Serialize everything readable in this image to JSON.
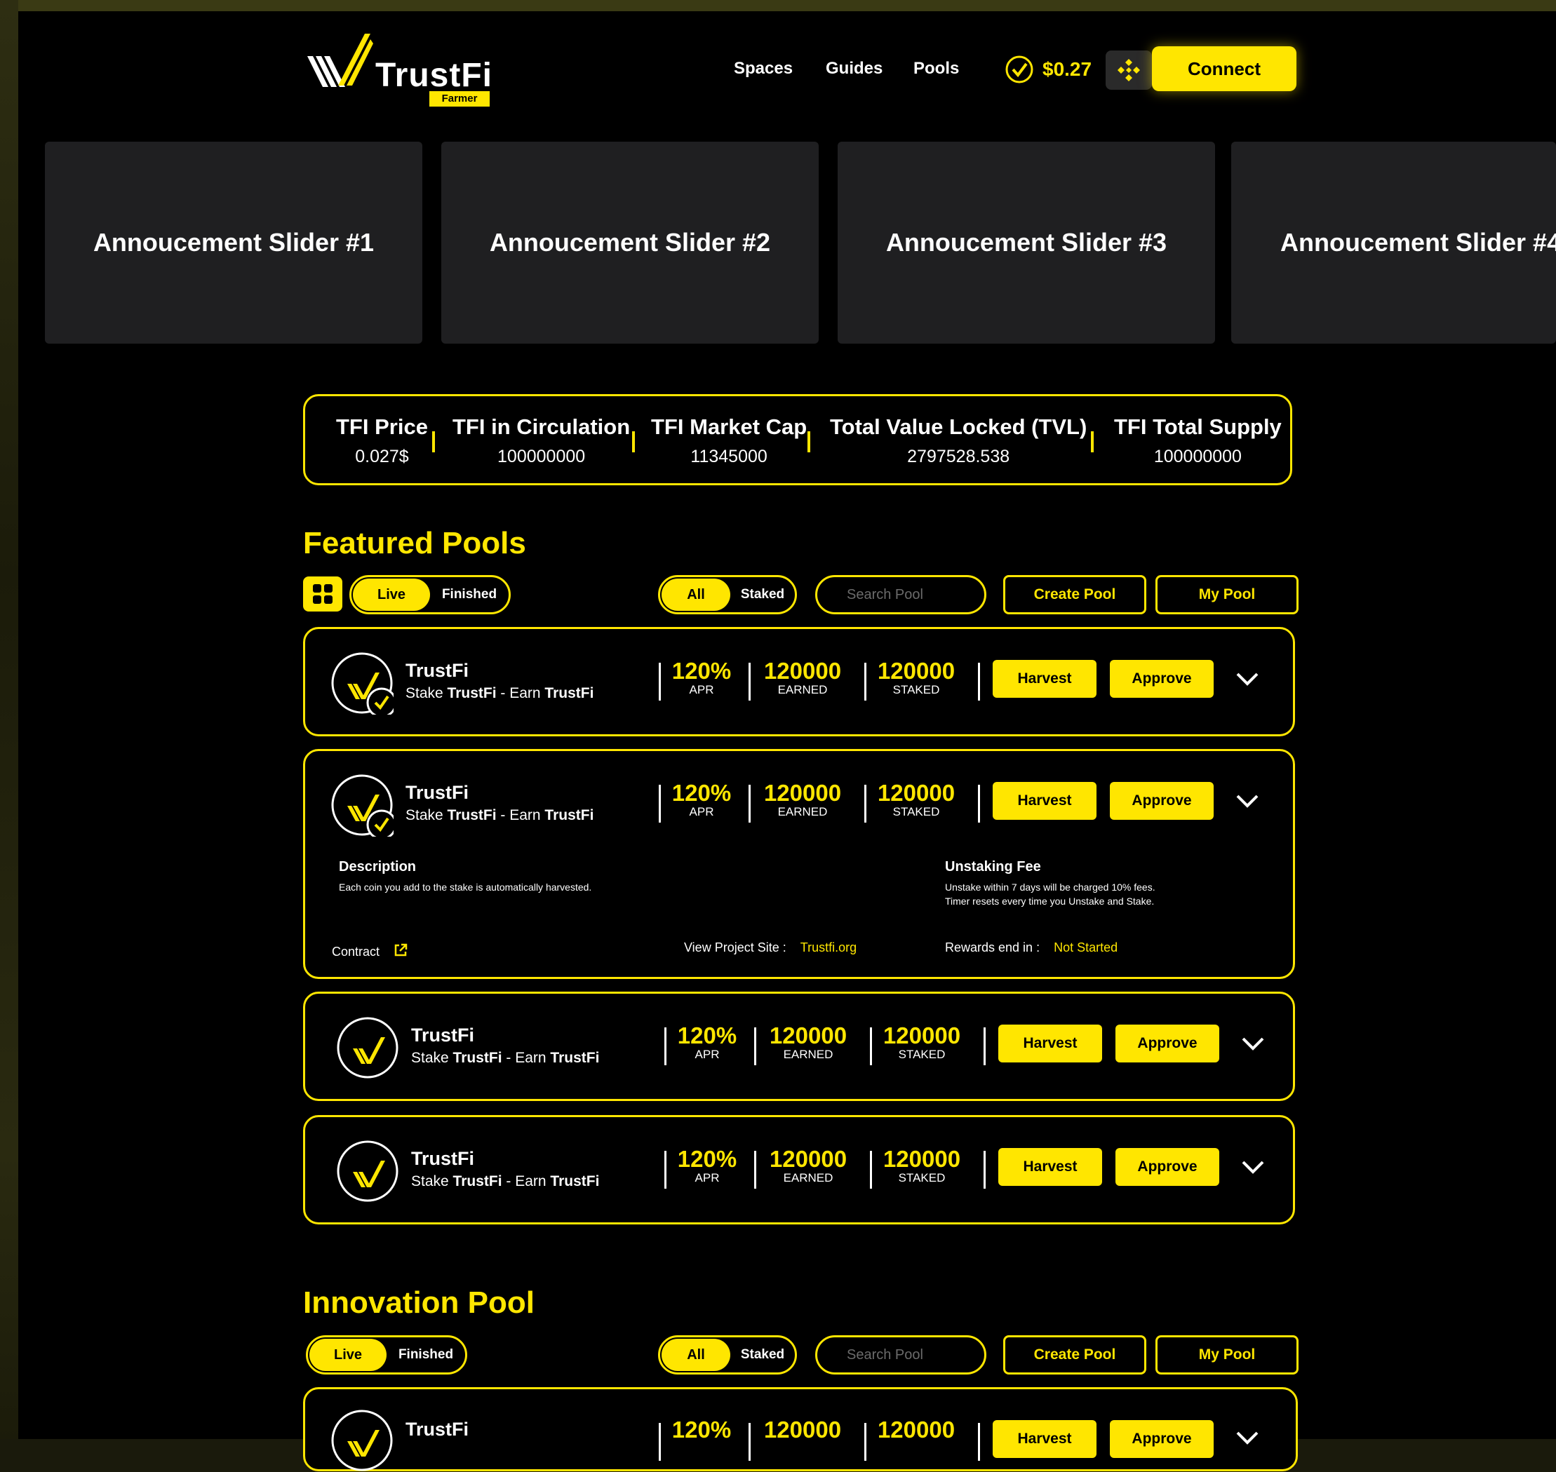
{
  "header": {
    "logo_text": "TrustFi",
    "logo_badge": "Farmer",
    "nav": [
      "Spaces",
      "Guides",
      "Pools"
    ],
    "price": "$0.27",
    "connect_label": "Connect"
  },
  "sliders": [
    "Annoucement Slider #1",
    "Annoucement Slider #2",
    "Annoucement Slider #3",
    "Annoucement Slider #4"
  ],
  "stats": [
    {
      "label": "TFI Price",
      "value": "0.027$"
    },
    {
      "label": "TFI in Circulation",
      "value": "100000000"
    },
    {
      "label": "TFI Market Cap",
      "value": "11345000"
    },
    {
      "label": "Total Value Locked (TVL)",
      "value": "2797528.538"
    },
    {
      "label": "TFI Total Supply",
      "value": "100000000"
    }
  ],
  "featured": {
    "title": "Featured Pools",
    "toggle_live": "Live",
    "toggle_finished": "Finished",
    "filter_all": "All",
    "filter_staked": "Staked",
    "search_placeholder": "Search Pool",
    "create_label": "Create Pool",
    "mypool_label": "My Pool"
  },
  "pool_common": {
    "name": "TrustFi",
    "sub_stake": "Stake ",
    "sub_token1": "TrustFi",
    "sub_mid": " - Earn ",
    "sub_token2": "TrustFi",
    "apr": "120%",
    "apr_label": "APR",
    "earned": "120000",
    "earned_label": "EARNED",
    "staked": "120000",
    "staked_label": "STAKED",
    "harvest_label": "Harvest",
    "approve_label": "Approve"
  },
  "pool_detail": {
    "description_title": "Description",
    "description_text": "Each coin you add to the stake is automatically harvested.",
    "fee_title": "Unstaking Fee",
    "fee_line1": "Unstake within 7 days will be charged 10% fees.",
    "fee_line2": "Timer resets every time you Unstake and Stake.",
    "contract_label": "Contract",
    "project_label": "View Project Site :",
    "project_link": "Trustfi.org",
    "rewards_label": "Rewards end in :",
    "rewards_value": "Not Started"
  },
  "innovation": {
    "title": "Innovation Pool",
    "toggle_live": "Live",
    "toggle_finished": "Finished",
    "filter_all": "All",
    "filter_staked": "Staked",
    "search_placeholder": "Search Pool",
    "create_label": "Create Pool",
    "mypool_label": "My Pool"
  },
  "colors": {
    "accent": "#ffe600",
    "background": "#000000",
    "card": "#1f1f21"
  }
}
